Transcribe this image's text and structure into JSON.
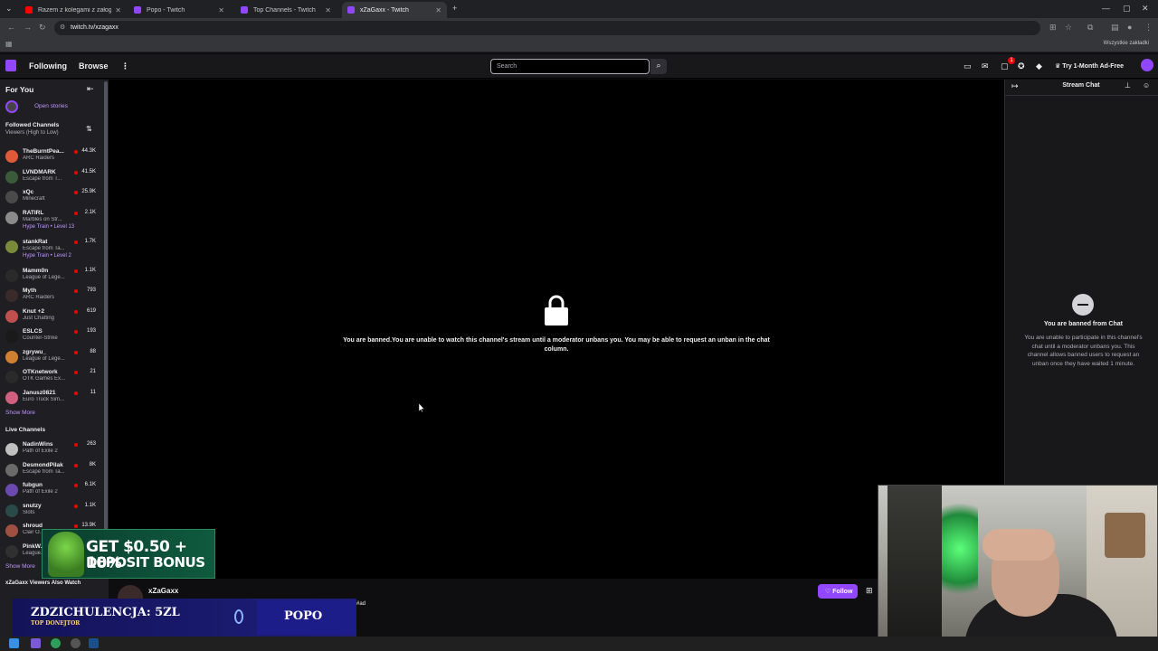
{
  "browser": {
    "tabs": [
      {
        "title": "Razem z kolegami z załogi przyl...",
        "color": "#ff0000"
      },
      {
        "title": "Popo - Twitch",
        "color": "#9147ff"
      },
      {
        "title": "Top Channels - Twitch",
        "color": "#9147ff"
      },
      {
        "title": "xZaGaxx - Twitch",
        "color": "#9147ff"
      }
    ],
    "url": "twitch.tv/xzagaxx",
    "bookmarks_right": "Wszystkie zakładki"
  },
  "topnav": {
    "following": "Following",
    "browse": "Browse",
    "search_placeholder": "Search",
    "notification_count": "1",
    "ad_free": "Try 1-Month Ad-Free"
  },
  "sidebar": {
    "for_you": "For You",
    "open_stories": "Open stories",
    "followed_title": "Followed Channels",
    "followed_sort": "Viewers (High to Low)",
    "followed": [
      {
        "name": "TheBurntPea...",
        "game": "ARC Raiders",
        "viewers": "44.3K",
        "color": "#e05a3a"
      },
      {
        "name": "LVNDMARK",
        "game": "Escape from T...",
        "viewers": "41.5K",
        "color": "#3a5a3a"
      },
      {
        "name": "xQc",
        "game": "Minecraft",
        "viewers": "25.9K",
        "color": "#4a4a4a"
      },
      {
        "name": "RATIRL",
        "game": "Marbles on Str...",
        "extra": "Hype Train • Level 13",
        "viewers": "2.1K",
        "color": "#8a8a8a"
      },
      {
        "name": "stankRat",
        "game": "Escape from Ta...",
        "extra": "Hype Train • Level 2",
        "viewers": "1.7K",
        "color": "#7a8a3a"
      },
      {
        "name": "Mamm0n",
        "game": "League of Lege...",
        "viewers": "1.1K",
        "color": "#2a2a2a"
      },
      {
        "name": "Myth",
        "game": "ARC Raiders",
        "viewers": "793",
        "color": "#3a2a2a"
      },
      {
        "name": "Knut +2",
        "game": "Just Chatting",
        "viewers": "619",
        "color": "#c05050"
      },
      {
        "name": "ESLCS",
        "game": "Counter-Strike",
        "viewers": "193",
        "color": "#1a1a1a"
      },
      {
        "name": "zgrywu_",
        "game": "League of Lege...",
        "viewers": "88",
        "color": "#d08030"
      },
      {
        "name": "OTKnetwork",
        "game": "OTK Games Ex...",
        "viewers": "21",
        "color": "#2a2a2a"
      },
      {
        "name": "Janusz0821",
        "game": "Euro Truck Sim...",
        "viewers": "11",
        "color": "#d06080"
      }
    ],
    "show_more_1": "Show More",
    "live_title": "Live Channels",
    "live": [
      {
        "name": "NadinWins",
        "game": "Path of Exile 2",
        "viewers": "263",
        "color": "#c0c0c0"
      },
      {
        "name": "DesmondPilak",
        "game": "Escape from Ta...",
        "viewers": "8K",
        "color": "#6a6a6a"
      },
      {
        "name": "fubgun",
        "game": "Path of Exile 2",
        "viewers": "6.1K",
        "color": "#6a4ab0"
      },
      {
        "name": "snutzy",
        "game": "Slots",
        "viewers": "1.1K",
        "color": "#2a4a4a"
      },
      {
        "name": "shroud",
        "game": "Clair O...",
        "viewers": "13.9K",
        "color": "#a05040"
      },
      {
        "name": "PinkW...",
        "game": "League...",
        "viewers": "",
        "color": "#303030"
      }
    ],
    "show_more_2": "Show More",
    "also_watch": "xZaGaxx Viewers Also Watch"
  },
  "player": {
    "ban_message": "You are banned.You are unable to watch this channel's stream until a moderator unbans you. You may be able to request an unban in the chat column."
  },
  "channel": {
    "name": "xZaGaxx",
    "tag": "#ad",
    "follow": "Follow"
  },
  "chat": {
    "title": "Stream Chat",
    "ban_title": "You are banned from Chat",
    "ban_body": "You are unable to participate in this channel's chat until a moderator unbans you. This channel allows banned users to request an unban once they have waited 1 minute."
  },
  "overlays": {
    "ad_line1": "GET $0.50 + 10%",
    "ad_line2": "DEPOSIT BONUS",
    "donation_text": "ZDZICHULENCJA: 5ZL",
    "donation_sub": "TOP DONEJTOR",
    "donation_name": "POPO"
  }
}
